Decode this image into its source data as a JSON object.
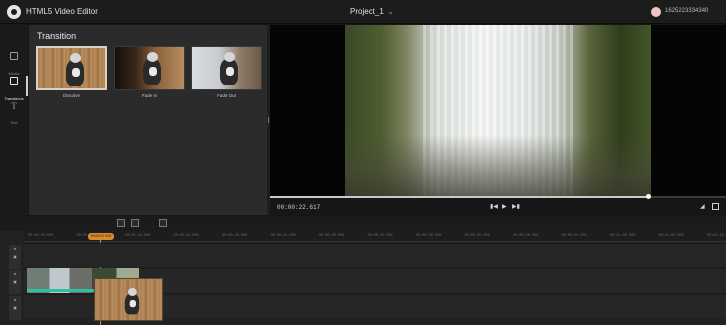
{
  "app": {
    "title": "HTML5 Video Editor",
    "project": "Project_1",
    "user_id": "1625223334340"
  },
  "rail": [
    {
      "label": "Media",
      "icon": "image-icon"
    },
    {
      "label": "Transitions",
      "icon": "transitions-icon"
    },
    {
      "label": "Text",
      "icon": "text-icon"
    }
  ],
  "panel": {
    "title": "Transition",
    "items": [
      {
        "label": "Dissolve"
      },
      {
        "label": "Fade In"
      },
      {
        "label": "Fade Out"
      }
    ]
  },
  "viewer": {
    "timecode": "00:00:22.617",
    "progress": 0.83
  },
  "timeline": {
    "ticks": [
      "00:00:00.000",
      "00:00:05.000",
      "00:00:10.000",
      "00:00:15.000",
      "00:00:20.000",
      "00:00:25.000",
      "00:00:30.000",
      "00:00:35.000",
      "00:00:40.000",
      "00:00:45.000",
      "00:00:50.000",
      "00:00:55.000",
      "00:01:00.000",
      "00:01:05.000",
      "00:01:10.000"
    ],
    "playhead_time": "00:00:07.000"
  },
  "colors": {
    "accent": "#d98a2c",
    "clip_bar": "#2fbfa2"
  }
}
